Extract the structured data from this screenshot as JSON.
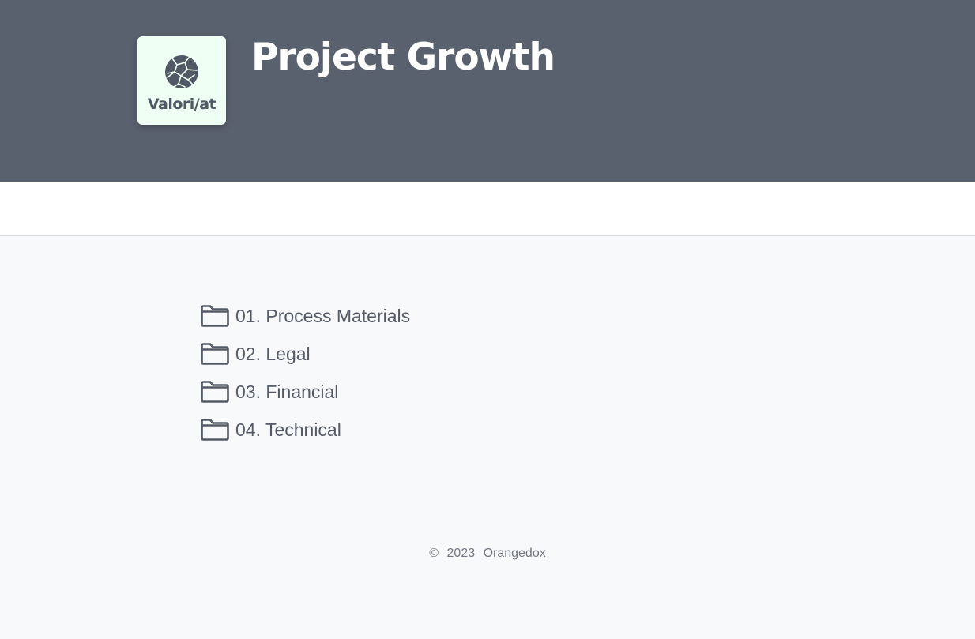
{
  "header": {
    "logo_text": "Valori/at",
    "title": "Project Growth",
    "background_color": "#5a616e"
  },
  "folders": [
    {
      "label": "01. Process Materials",
      "icon": "folder-icon"
    },
    {
      "label": "02. Legal",
      "icon": "folder-icon"
    },
    {
      "label": "03. Financial",
      "icon": "folder-icon"
    },
    {
      "label": "04. Technical",
      "icon": "folder-icon"
    }
  ],
  "footer": {
    "copyright_symbol": "©",
    "year": "2023",
    "company": "Orangedox"
  }
}
